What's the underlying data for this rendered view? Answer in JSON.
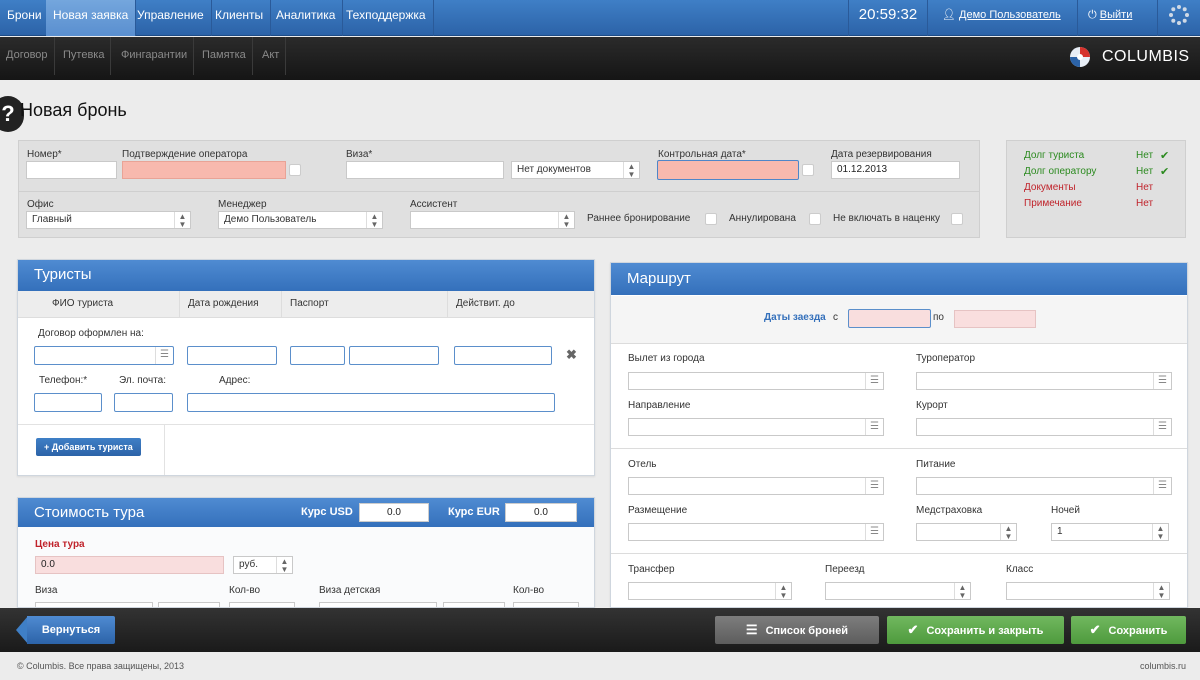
{
  "topnav": {
    "items": [
      "Брони",
      "Новая заявка",
      "Управление",
      "Клиенты",
      "Аналитика",
      "Техподдержка"
    ],
    "clock": "20:59:32",
    "user": "Демо Пользователь",
    "logout": "Выйти"
  },
  "subnav": {
    "items": [
      "Договор",
      "Путевка",
      "Фингарантии",
      "Памятка",
      "Акт"
    ]
  },
  "brand": {
    "name": "COLUMBIS"
  },
  "page": {
    "title": "Новая бронь",
    "help": "?"
  },
  "header_form": {
    "number_label": "Номер*",
    "operator_confirm_label": "Подтверждение оператора",
    "visa_label": "Виза*",
    "visa_docs_value": "Нет документов",
    "control_date_label": "Контрольная дата*",
    "reservation_date_label": "Дата резервирования",
    "reservation_date_value": "01.12.2013",
    "office_label": "Офис",
    "office_value": "Главный",
    "manager_label": "Менеджер",
    "manager_value": "Демо Пользователь",
    "assistant_label": "Ассистент",
    "early_booking_label": "Раннее бронирование",
    "cancelled_label": "Аннулирована",
    "exclude_markup_label": "Не включать в наценку"
  },
  "status": {
    "rows": [
      {
        "label": "Долг туриста",
        "value": "Нет"
      },
      {
        "label": "Долг оператору",
        "value": "Нет"
      },
      {
        "label": "Документы",
        "value": "Нет"
      },
      {
        "label": "Примечание",
        "value": "Нет"
      }
    ],
    "colors": {
      "ok": "#2b8a1f",
      "warn": "#c0232b"
    }
  },
  "tourists": {
    "title": "Туристы",
    "columns": [
      "ФИО туриста",
      "Дата рождения",
      "Паспорт",
      "Действит. до"
    ],
    "contract_label": "Договор оформлен на:",
    "phone_label": "Телефон:*",
    "email_label": "Эл. почта:",
    "address_label": "Адрес:",
    "add_button": "+ Добавить туриста"
  },
  "cost": {
    "title": "Стоимость тура",
    "usd_label": "Курс USD",
    "usd_value": "0.0",
    "eur_label": "Курс EUR",
    "eur_value": "0.0",
    "price_label": "Цена тура",
    "price_value": "0.0",
    "currency": "руб.",
    "visa_label": "Виза",
    "qty_label": "Кол-во",
    "child_visa_label": "Виза детская",
    "qty2_label": "Кол-во"
  },
  "route": {
    "title": "Маршрут",
    "dates_label": "Даты заезда",
    "from_label": "с",
    "to_label": "по",
    "departure_label": "Вылет из города",
    "operator_label": "Туроператор",
    "direction_label": "Направление",
    "resort_label": "Курорт",
    "hotel_label": "Отель",
    "meal_label": "Питание",
    "accommodation_label": "Размещение",
    "insurance_label": "Медстраховка",
    "nights_label": "Ночей",
    "nights_value": "1",
    "transfer_label": "Трансфер",
    "move_label": "Переезд",
    "class_label": "Класс"
  },
  "bottom": {
    "back": "Вернуться",
    "list": "Список броней",
    "save_close": "Сохранить и закрыть",
    "save": "Сохранить"
  },
  "footer": {
    "copyright": "© Columbis. Все права защищены, 2013",
    "site": "columbis.ru"
  }
}
